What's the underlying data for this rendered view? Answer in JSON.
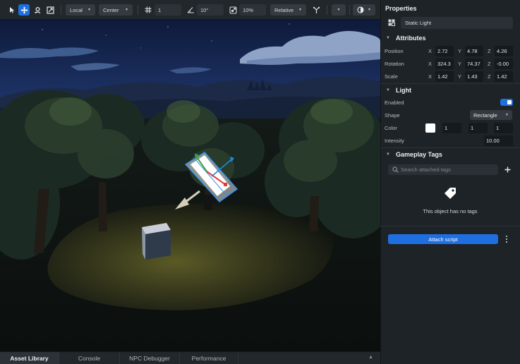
{
  "toolbar": {
    "tools": [
      {
        "name": "select-tool-icon",
        "active": false
      },
      {
        "name": "move-tool-icon",
        "active": true
      },
      {
        "name": "rotate-tool-icon",
        "active": false
      },
      {
        "name": "scale-tool-icon",
        "active": false
      }
    ],
    "space_label": "Local",
    "pivot_label": "Center",
    "grid_icon": "grid-icon",
    "grid_value": "1",
    "angle_icon": "angle-snap-icon",
    "angle_value": "10°",
    "scale_icon": "scale-snap-icon",
    "scale_value": "10%",
    "snap_mode_label": "Relative",
    "snap_mode_icon": "branch-icon",
    "view_icon": "camera-view-icon"
  },
  "viewport": {
    "selected_object": "Static Light",
    "gizmo_colors": {
      "x": "#e53935",
      "y": "#43a047",
      "z": "#1e88e5"
    }
  },
  "bottom_tabs": {
    "items": [
      {
        "label": "Asset Library",
        "active": true
      },
      {
        "label": "Console",
        "active": false
      },
      {
        "label": "NPC Debugger",
        "active": false
      },
      {
        "label": "Performance",
        "active": false
      }
    ],
    "collapse_icon": "chevron-up-icon"
  },
  "properties": {
    "title": "Properties",
    "object_icon": "object-icon",
    "object_name": "Static Light",
    "attributes": {
      "title": "Attributes",
      "position": {
        "label": "Position",
        "x": "2.72",
        "y": "4.78",
        "z": "4.26"
      },
      "rotation": {
        "label": "Rotation",
        "x": "324.3",
        "y": "74.37",
        "z": "-0.00"
      },
      "scale": {
        "label": "Scale",
        "x": "1.42",
        "y": "1.43",
        "z": "1.42"
      },
      "axis_x": "X",
      "axis_y": "Y",
      "axis_z": "Z"
    },
    "light": {
      "title": "Light",
      "enabled_label": "Enabled",
      "enabled": true,
      "shape_label": "Shape",
      "shape_value": "Rectangle",
      "color_label": "Color",
      "color_swatch": "#ffffff",
      "color_r": "1",
      "color_g": "1",
      "color_b": "1",
      "intensity_label": "Intensity",
      "intensity_value": "10.00"
    },
    "gameplay_tags": {
      "title": "Gameplay Tags",
      "search_placeholder": "Search attached tags",
      "empty_icon": "tag-icon",
      "empty_text": "This object has no tags"
    },
    "attach_script_label": "Attach script"
  },
  "colors": {
    "accent": "#1f6fe0",
    "panel_bg": "#1e2327",
    "field_bg": "#151a1e"
  }
}
